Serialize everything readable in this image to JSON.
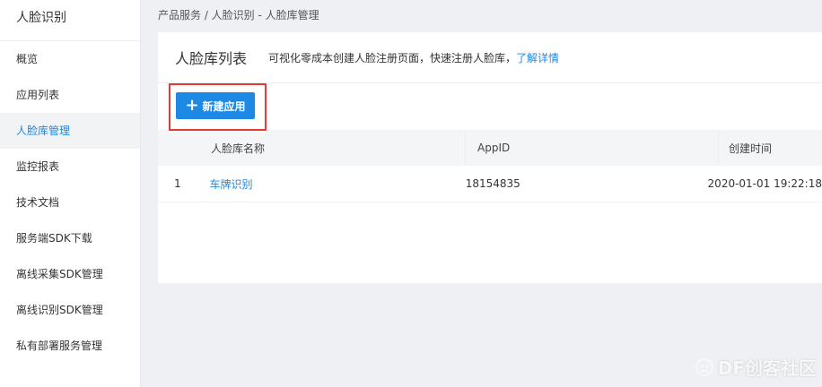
{
  "sidebar": {
    "title": "人脸识别",
    "items": [
      {
        "label": "概览"
      },
      {
        "label": "应用列表"
      },
      {
        "label": "人脸库管理",
        "active": true
      },
      {
        "label": "监控报表"
      },
      {
        "label": "技术文档"
      },
      {
        "label": "服务端SDK下载"
      },
      {
        "label": "离线采集SDK管理"
      },
      {
        "label": "离线识别SDK管理"
      },
      {
        "label": "私有部署服务管理"
      }
    ]
  },
  "breadcrumb": "产品服务 / 人脸识别 - 人脸库管理",
  "panel": {
    "title": "人脸库列表",
    "description": "可视化零成本创建人脸注册页面，快速注册人脸库，",
    "link": "了解详情"
  },
  "create_button": {
    "icon": "plus-icon",
    "label": "新建应用"
  },
  "table": {
    "headers": [
      "人脸库名称",
      "AppID",
      "创建时间"
    ],
    "rows": [
      {
        "index": "1",
        "name": "车牌识别",
        "appid": "18154835",
        "created": "2020-01-01 19:22:18"
      }
    ]
  },
  "watermark": {
    "text": "DF创客社区"
  },
  "colors": {
    "accent": "#1e88e5",
    "highlight": "#e53935"
  }
}
